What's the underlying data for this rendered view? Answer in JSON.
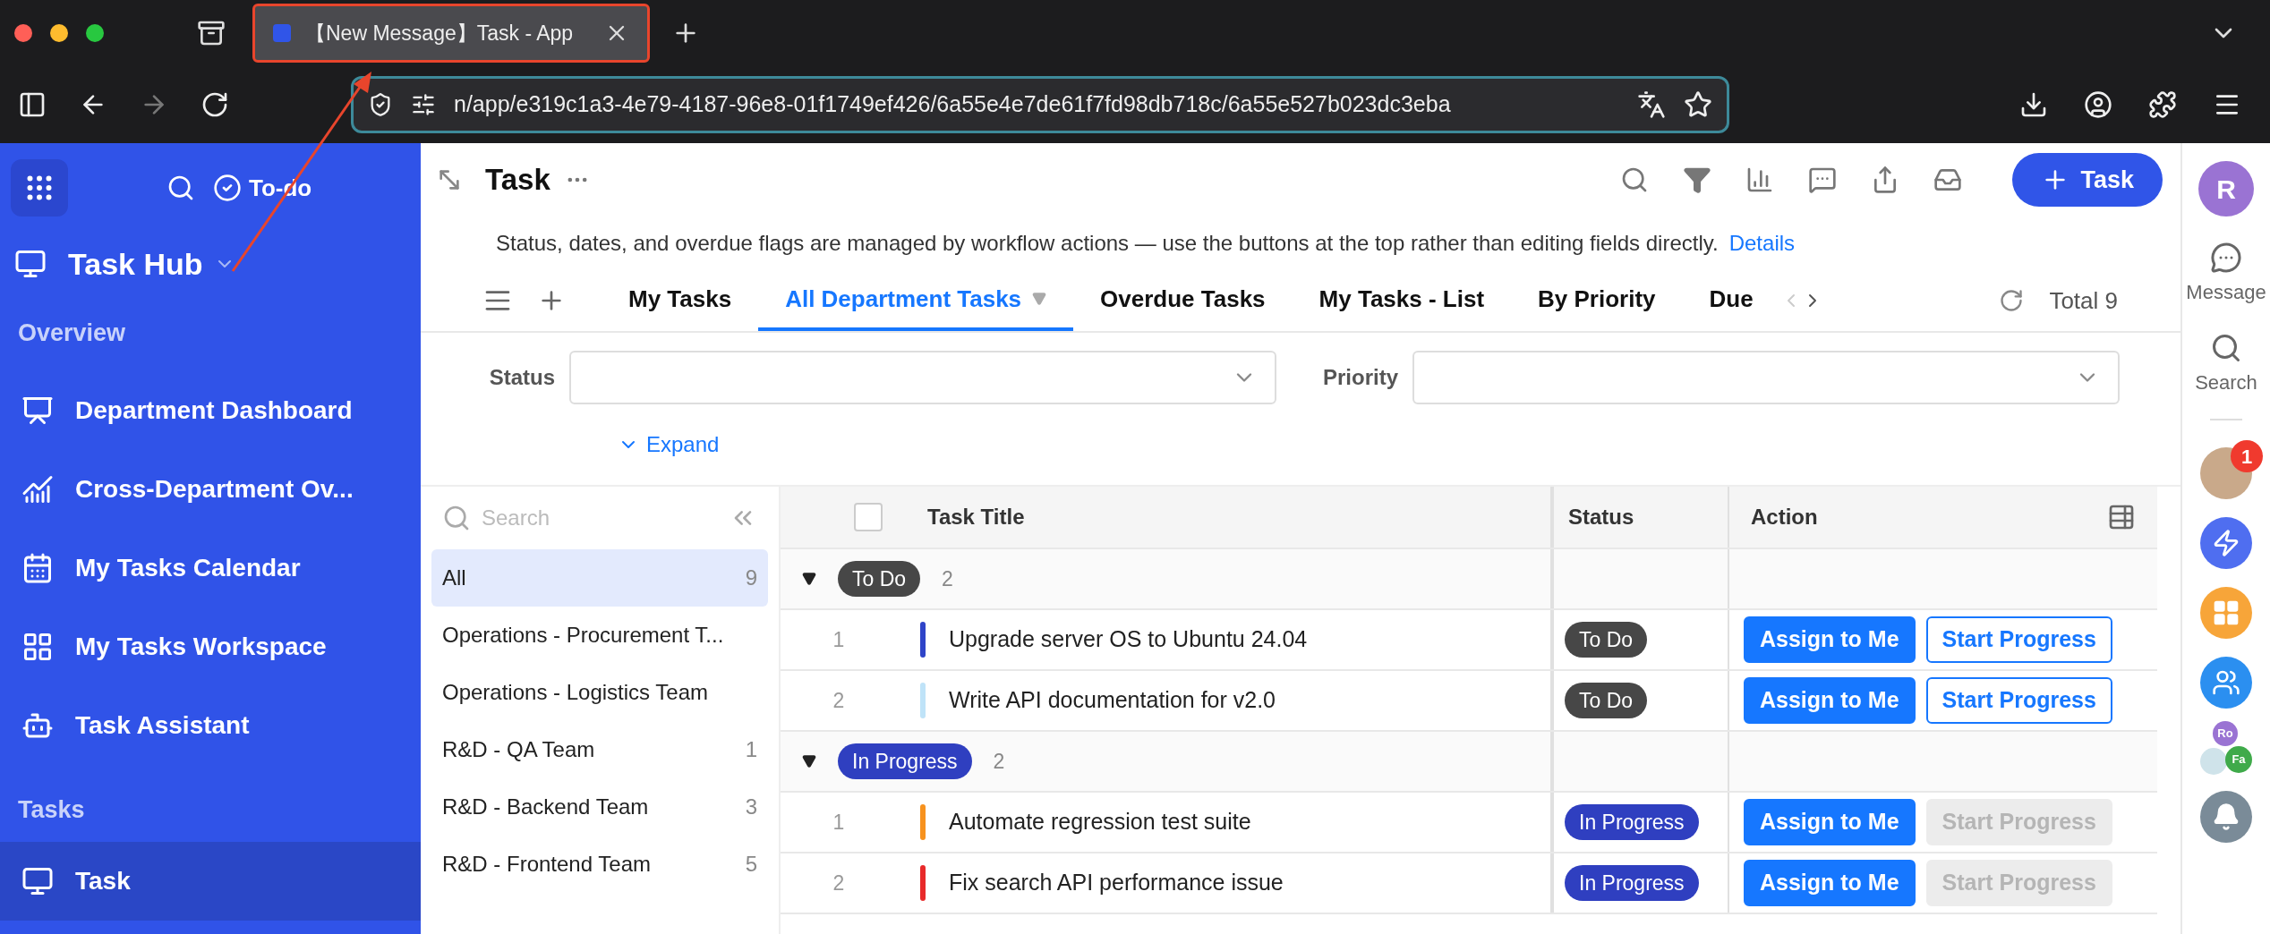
{
  "browser": {
    "tabs": [
      {
        "title": "【New Message】Task - App",
        "selected": true
      }
    ],
    "url": "n/app/e319c1a3-4e79-4187-96e8-01f1749ef426/6a55e4e7de61f7fd98db718c/6a55e527b023dc3eba"
  },
  "sidebar": {
    "todo": "To-do",
    "app_title": "Task Hub",
    "sections": [
      {
        "title": "Overview",
        "items": [
          {
            "label": "Department Dashboard",
            "selected": false
          },
          {
            "label": "Cross-Department Ov...",
            "selected": false
          },
          {
            "label": "My Tasks Calendar",
            "selected": false
          },
          {
            "label": "My Tasks Workspace",
            "selected": false
          },
          {
            "label": "Task Assistant",
            "selected": false
          }
        ]
      },
      {
        "title": "Tasks",
        "items": [
          {
            "label": "Task",
            "selected": true
          }
        ]
      }
    ]
  },
  "page": {
    "title": "Task",
    "add_button": "Task",
    "notice": "Status, dates, and overdue flags are managed by workflow actions — use the buttons at the top rather than editing fields directly.",
    "notice_link": "Details",
    "views": [
      {
        "label": "My Tasks",
        "selected": false
      },
      {
        "label": "All Department Tasks",
        "selected": true
      },
      {
        "label": "Overdue Tasks",
        "selected": false
      },
      {
        "label": "My Tasks - List",
        "selected": false
      },
      {
        "label": "By Priority",
        "selected": false
      },
      {
        "label": "Due",
        "selected": false
      }
    ],
    "total": "Total 9",
    "filters": [
      {
        "label": "Status"
      },
      {
        "label": "Priority"
      }
    ],
    "expand": "Expand",
    "group_panel": {
      "placeholder": "Search",
      "items": [
        {
          "label": "All",
          "count": "9",
          "selected": true
        },
        {
          "label": "Operations - Procurement T...",
          "selected": false
        },
        {
          "label": "Operations - Logistics Team",
          "selected": false
        },
        {
          "label": "R&D - QA Team",
          "count": "1",
          "selected": false
        },
        {
          "label": "R&D - Backend Team",
          "count": "3",
          "selected": false
        },
        {
          "label": "R&D - Frontend Team",
          "count": "5",
          "selected": false
        }
      ]
    },
    "table": {
      "select_all_checked": false,
      "columns": [
        "Task Title",
        "Status",
        "Action"
      ],
      "groups": [
        {
          "status": "To Do",
          "color": "#474747",
          "count": "2",
          "rows": [
            {
              "number": "1",
              "color": "#2f44c8",
              "title": "Upgrade server OS to Ubuntu 24.04",
              "status": "To Do",
              "actions": [
                {
                  "label": "Assign to Me",
                  "kind": "primary",
                  "disabled": false
                },
                {
                  "label": "Start Progress",
                  "kind": "outline",
                  "disabled": false
                }
              ]
            },
            {
              "number": "2",
              "color": "#bfe3f8",
              "title": "Write API documentation for v2.0",
              "status": "To Do",
              "actions": [
                {
                  "label": "Assign to Me",
                  "kind": "primary",
                  "disabled": false
                },
                {
                  "label": "Start Progress",
                  "kind": "outline",
                  "disabled": false
                }
              ]
            }
          ]
        },
        {
          "status": "In Progress",
          "color": "#2f3fc0",
          "count": "2",
          "rows": [
            {
              "number": "1",
              "color": "#f7921e",
              "title": "Automate regression test suite",
              "status": "In Progress",
              "actions": [
                {
                  "label": "Assign to Me",
                  "kind": "primary",
                  "disabled": false
                },
                {
                  "label": "Start Progress",
                  "kind": "outline",
                  "disabled": true
                }
              ]
            },
            {
              "number": "2",
              "color": "#e82a2a",
              "title": "Fix search API performance issue",
              "status": "In Progress",
              "actions": [
                {
                  "label": "Assign to Me",
                  "kind": "primary",
                  "disabled": false
                },
                {
                  "label": "Start Progress",
                  "kind": "outline",
                  "disabled": true
                }
              ]
            }
          ]
        }
      ]
    }
  },
  "rail": {
    "avatar": "R",
    "items": [
      {
        "label": "Message"
      },
      {
        "label": "Search"
      }
    ],
    "badge": "1",
    "group_avatars": [
      "Ro",
      "Fa"
    ]
  }
}
